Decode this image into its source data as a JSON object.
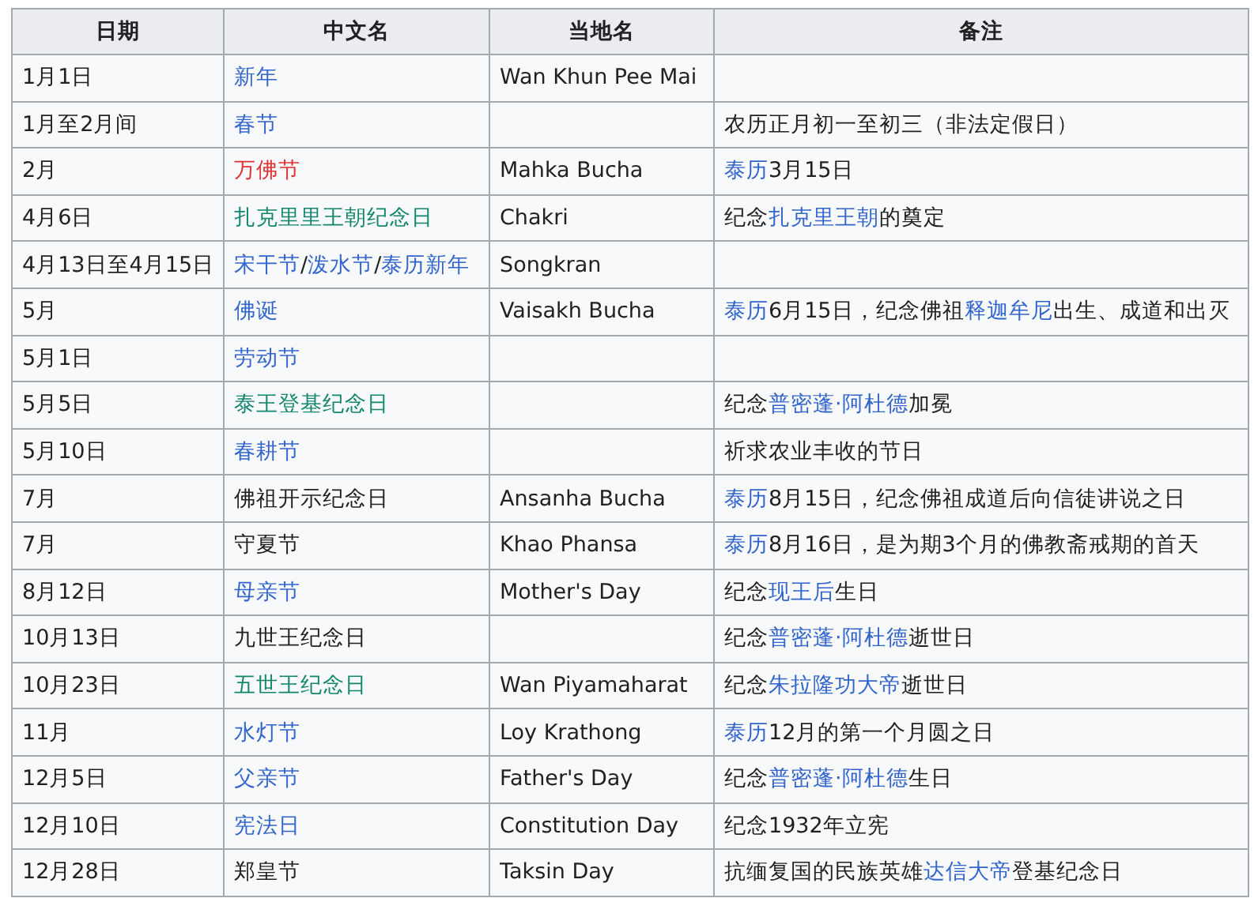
{
  "table": {
    "columns": [
      "日期",
      "中文名",
      "当地名",
      "备注"
    ],
    "rows": [
      {
        "cells": [
          [
            "1月1日"
          ],
          [
            {
              "text": "新年",
              "kind": "link"
            }
          ],
          [
            "Wan Khun Pee Mai"
          ],
          []
        ]
      },
      {
        "cells": [
          [
            "1月至2月间"
          ],
          [
            {
              "text": "春节",
              "kind": "link"
            }
          ],
          [],
          [
            "农历正月初一至初三（非法定假日）"
          ]
        ]
      },
      {
        "cells": [
          [
            "2月"
          ],
          [
            {
              "text": "万佛节",
              "kind": "redlink"
            }
          ],
          [
            "Mahka Bucha"
          ],
          [
            {
              "text": "泰历",
              "kind": "link"
            },
            "3月15日"
          ]
        ]
      },
      {
        "cells": [
          [
            "4月6日"
          ],
          [
            {
              "text": "扎克里里王朝纪念日",
              "kind": "redirect"
            }
          ],
          [
            "Chakri"
          ],
          [
            "纪念",
            {
              "text": "扎克里王朝",
              "kind": "link"
            },
            "的奠定"
          ]
        ]
      },
      {
        "cells": [
          [
            "4月13日至4月15日"
          ],
          [
            {
              "text": "宋干节",
              "kind": "link"
            },
            "/",
            {
              "text": "泼水节",
              "kind": "link"
            },
            "/",
            {
              "text": "泰历新年",
              "kind": "link"
            }
          ],
          [
            "Songkran"
          ],
          []
        ]
      },
      {
        "cells": [
          [
            "5月"
          ],
          [
            {
              "text": "佛诞",
              "kind": "link"
            }
          ],
          [
            "Vaisakh Bucha"
          ],
          [
            {
              "text": "泰历",
              "kind": "link"
            },
            "6月15日，纪念佛祖",
            {
              "text": "释迦牟尼",
              "kind": "link"
            },
            "出生、成道和出灭"
          ]
        ]
      },
      {
        "cells": [
          [
            "5月1日"
          ],
          [
            {
              "text": "劳动节",
              "kind": "link"
            }
          ],
          [],
          []
        ]
      },
      {
        "cells": [
          [
            "5月5日"
          ],
          [
            {
              "text": "泰王登基纪念日",
              "kind": "redirect"
            }
          ],
          [],
          [
            "纪念",
            {
              "text": "普密蓬·阿杜德",
              "kind": "link"
            },
            "加冕"
          ]
        ]
      },
      {
        "cells": [
          [
            "5月10日"
          ],
          [
            {
              "text": "春耕节",
              "kind": "link"
            }
          ],
          [],
          [
            "祈求农业丰收的节日"
          ]
        ]
      },
      {
        "cells": [
          [
            "7月"
          ],
          [
            "佛祖开示纪念日"
          ],
          [
            "Ansanha Bucha"
          ],
          [
            {
              "text": "泰历",
              "kind": "link"
            },
            "8月15日，纪念佛祖成道后向信徒讲说之日"
          ]
        ]
      },
      {
        "cells": [
          [
            "7月"
          ],
          [
            "守夏节"
          ],
          [
            "Khao Phansa"
          ],
          [
            {
              "text": "泰历",
              "kind": "link"
            },
            "8月16日，是为期3个月的佛教斋戒期的首天"
          ]
        ]
      },
      {
        "cells": [
          [
            "8月12日"
          ],
          [
            {
              "text": "母亲节",
              "kind": "link"
            }
          ],
          [
            "Mother's Day"
          ],
          [
            "纪念",
            {
              "text": "现王后",
              "kind": "link"
            },
            "生日"
          ]
        ]
      },
      {
        "cells": [
          [
            "10月13日"
          ],
          [
            "九世王纪念日"
          ],
          [],
          [
            "纪念",
            {
              "text": "普密蓬·阿杜德",
              "kind": "link"
            },
            "逝世日"
          ]
        ]
      },
      {
        "cells": [
          [
            "10月23日"
          ],
          [
            {
              "text": "五世王纪念日",
              "kind": "redirect"
            }
          ],
          [
            "Wan Piyamaharat"
          ],
          [
            "纪念",
            {
              "text": "朱拉隆功大帝",
              "kind": "link"
            },
            "逝世日"
          ]
        ]
      },
      {
        "cells": [
          [
            "11月"
          ],
          [
            {
              "text": "水灯节",
              "kind": "link"
            }
          ],
          [
            "Loy Krathong"
          ],
          [
            {
              "text": "泰历",
              "kind": "link"
            },
            "12月的第一个月圆之日"
          ]
        ]
      },
      {
        "cells": [
          [
            "12月5日"
          ],
          [
            {
              "text": "父亲节",
              "kind": "link"
            }
          ],
          [
            "Father's Day"
          ],
          [
            "纪念",
            {
              "text": "普密蓬·阿杜德",
              "kind": "link"
            },
            "生日"
          ]
        ]
      },
      {
        "cells": [
          [
            "12月10日"
          ],
          [
            {
              "text": "宪法日",
              "kind": "link"
            }
          ],
          [
            "Constitution Day"
          ],
          [
            "纪念1932年立宪"
          ]
        ]
      },
      {
        "cells": [
          [
            "12月28日"
          ],
          [
            "郑皇节"
          ],
          [
            "Taksin Day"
          ],
          [
            "抗缅复国的民族英雄",
            {
              "text": "达信大帝",
              "kind": "link"
            },
            "登基纪念日"
          ]
        ]
      }
    ]
  }
}
